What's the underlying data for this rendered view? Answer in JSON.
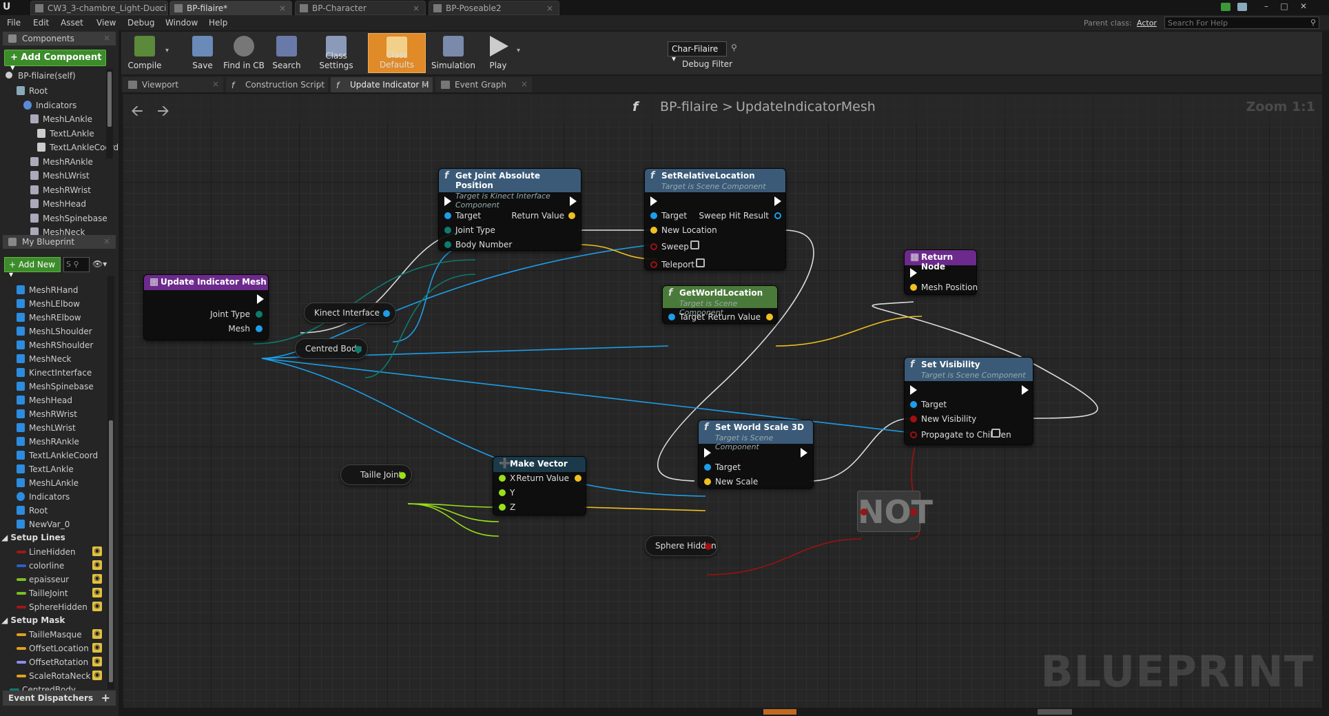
{
  "titlebar": {
    "tabs": [
      {
        "label": "CW3_3-chambre_Light-Ducci"
      },
      {
        "label": "BP-filaire*"
      },
      {
        "label": "BP-Character"
      },
      {
        "label": "BP-Poseable2"
      }
    ],
    "close_glyph": "×",
    "window_buttons": [
      "–",
      "□",
      "✕"
    ]
  },
  "menubar": {
    "items": [
      "File",
      "Edit",
      "Asset",
      "View",
      "Debug",
      "Window",
      "Help"
    ],
    "parent_class_label": "Parent class:",
    "parent_class_value": "Actor",
    "help_search_placeholder": "Search For Help"
  },
  "components": {
    "title": "Components",
    "add_button": "+ Add Component ▾",
    "self_item": "BP-filaire(self)",
    "tree": [
      {
        "label": "Root",
        "indent": 0,
        "icon": "root-icon"
      },
      {
        "label": "Indicators",
        "indent": 1,
        "icon": "sphere-icon"
      },
      {
        "label": "MeshLAnkle",
        "indent": 2,
        "icon": "mesh-icon"
      },
      {
        "label": "TextLAnkle",
        "indent": 3,
        "icon": "text-icon"
      },
      {
        "label": "TextLAnkleCoord",
        "indent": 3,
        "icon": "text-icon"
      },
      {
        "label": "MeshRAnkle",
        "indent": 2,
        "icon": "mesh-icon"
      },
      {
        "label": "MeshLWrist",
        "indent": 2,
        "icon": "mesh-icon"
      },
      {
        "label": "MeshRWrist",
        "indent": 2,
        "icon": "mesh-icon"
      },
      {
        "label": "MeshHead",
        "indent": 2,
        "icon": "mesh-icon"
      },
      {
        "label": "MeshSpinebase",
        "indent": 2,
        "icon": "mesh-icon"
      },
      {
        "label": "MeshNeck",
        "indent": 2,
        "icon": "mesh-icon"
      }
    ]
  },
  "my_blueprint": {
    "title": "My Blueprint",
    "add_new": "+ Add New ▾",
    "search_placeholder": "S",
    "variables": [
      {
        "label": "MeshRHand",
        "icon": "mesh-icon"
      },
      {
        "label": "MeshLElbow",
        "icon": "mesh-icon"
      },
      {
        "label": "MeshRElbow",
        "icon": "mesh-icon"
      },
      {
        "label": "MeshLShoulder",
        "icon": "mesh-icon"
      },
      {
        "label": "MeshRShoulder",
        "icon": "mesh-icon"
      },
      {
        "label": "MeshNeck",
        "icon": "mesh-icon"
      },
      {
        "label": "KinectInterface",
        "icon": "kinect-icon"
      },
      {
        "label": "MeshSpinebase",
        "icon": "mesh-icon"
      },
      {
        "label": "MeshHead",
        "icon": "mesh-icon"
      },
      {
        "label": "MeshRWrist",
        "icon": "mesh-icon"
      },
      {
        "label": "MeshLWrist",
        "icon": "mesh-icon"
      },
      {
        "label": "MeshRAnkle",
        "icon": "mesh-icon"
      },
      {
        "label": "TextLAnkleCoord",
        "icon": "text-icon"
      },
      {
        "label": "TextLAnkle",
        "icon": "text-icon"
      },
      {
        "label": "MeshLAnkle",
        "icon": "mesh-icon"
      },
      {
        "label": "Indicators",
        "icon": "sphere-icon"
      },
      {
        "label": "Root",
        "icon": "root-icon"
      },
      {
        "label": "NewVar_0",
        "icon": "var-icon"
      }
    ],
    "categories": [
      {
        "label": "Setup Lines",
        "vars": [
          {
            "label": "LineHidden",
            "color": "#a01818"
          },
          {
            "label": "colorline",
            "color": "#2c5fc8"
          },
          {
            "label": "epaisseur",
            "color": "#7ac020"
          },
          {
            "label": "TailleJoint",
            "color": "#7ac020"
          },
          {
            "label": "SphereHidden",
            "color": "#a01818"
          }
        ]
      },
      {
        "label": "Setup Mask",
        "vars": [
          {
            "label": "TailleMasque",
            "color": "#e0a020"
          },
          {
            "label": "OffsetLocation",
            "color": "#e0a020"
          },
          {
            "label": "OffsetRotation",
            "color": "#8c8cf0"
          },
          {
            "label": "ScaleRotaNeck",
            "color": "#e0a020"
          }
        ]
      }
    ],
    "last_item": "CentredBody",
    "event_dispatchers": "Event Dispatchers"
  },
  "toolbar": {
    "tools": [
      {
        "label": "Compile",
        "icon": "compile-icon"
      },
      {
        "label": "Save",
        "icon": "save-icon"
      },
      {
        "label": "Find in CB",
        "icon": "find-in-cb-icon"
      },
      {
        "label": "Search",
        "icon": "search-icon"
      },
      {
        "label": "Class Settings",
        "icon": "class-settings-icon"
      },
      {
        "label": "Class Defaults",
        "icon": "class-defaults-icon"
      },
      {
        "label": "Simulation",
        "icon": "simulation-icon"
      },
      {
        "label": "Play",
        "icon": "play-icon"
      }
    ],
    "debug_combo": "Char-Filaire ▾",
    "debug_filter": "Debug Filter"
  },
  "editor_tabs": [
    {
      "label": "Viewport"
    },
    {
      "label": "Construction Script"
    },
    {
      "label": "Update Indicator M"
    },
    {
      "label": "Event Graph"
    }
  ],
  "graph": {
    "breadcrumb_root": "BP-filaire",
    "breadcrumb_sep": ">",
    "breadcrumb_fn": "UpdateIndicatorMesh",
    "zoom": "Zoom 1:1",
    "watermark": "BLUEPRINT",
    "function_glyph": "f",
    "nodes": {
      "update_indicator_mesh": {
        "title": "Update Indicator Mesh",
        "pins": [
          "Joint Type",
          "Mesh"
        ]
      },
      "get_joint_absolute_position": {
        "title": "Get Joint Absolute Position",
        "subtitle": "Target is Kinect Interface Component",
        "inputs": [
          "Target",
          "Joint Type",
          "Body Number"
        ],
        "output": "Return Value"
      },
      "set_relative_location": {
        "title": "SetRelativeLocation",
        "subtitle": "Target is Scene Component",
        "inputs": [
          "Target",
          "New Location",
          "Sweep",
          "Teleport"
        ],
        "output": "Sweep Hit Result"
      },
      "get_world_location": {
        "title": "GetWorldLocation",
        "subtitle": "Target is Scene Component",
        "input": "Target",
        "output": "Return Value"
      },
      "return_node": {
        "title": "Return Node",
        "input": "Mesh Position"
      },
      "set_visibility": {
        "title": "Set Visibility",
        "subtitle": "Target is Scene Component",
        "inputs": [
          "Target",
          "New Visibility",
          "Propagate to Children"
        ]
      },
      "set_world_scale": {
        "title": "Set World Scale 3D",
        "subtitle": "Target is Scene Component",
        "inputs": [
          "Target",
          "New Scale"
        ]
      },
      "make_vector": {
        "title": "Make Vector",
        "inputs": [
          "X",
          "Y",
          "Z"
        ],
        "output": "Return Value"
      },
      "kinect_interface": {
        "label": "Kinect Interface"
      },
      "centred_body": {
        "label": "Centred Body"
      },
      "taille_joint": {
        "label": "Taille Joint"
      },
      "sphere_hidden": {
        "label": "Sphere Hidden"
      },
      "not": {
        "label": "NOT"
      }
    }
  },
  "colors": {
    "exec": "#ffffff",
    "object_pin": "#1c9ee8",
    "vector_pin": "#f0c020",
    "float_pin": "#9ae018",
    "bool_pin": "#a01010",
    "byte_pin": "#0f7a6e",
    "accent": "#e08a28",
    "func_header": "#3a5a78",
    "pure_header": "#4a7a3a",
    "entry_header": "#6c2a8c",
    "make_header": "#1a3a4a"
  }
}
